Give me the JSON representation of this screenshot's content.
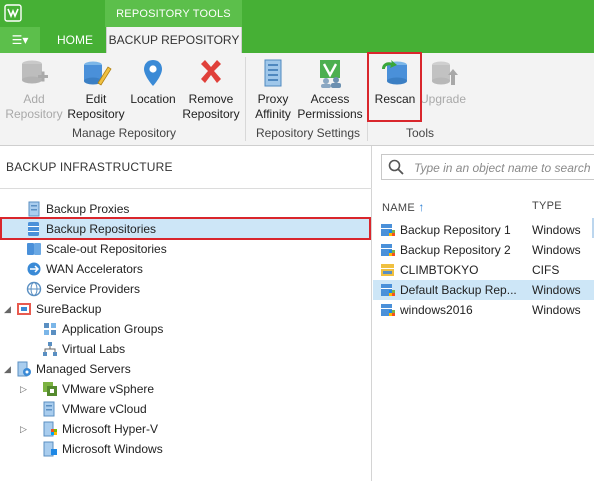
{
  "title_bar": {
    "context_tab": "REPOSITORY TOOLS"
  },
  "tabs": {
    "menu_glyph": "☰▾",
    "home": "HOME",
    "backup_repository": "BACKUP REPOSITORY"
  },
  "ribbon": {
    "manage": {
      "label": "Manage Repository",
      "add": {
        "line1": "Add",
        "line2": "Repository",
        "icon": "database-add-icon",
        "enabled": false
      },
      "edit": {
        "line1": "Edit",
        "line2": "Repository",
        "icon": "database-edit-icon"
      },
      "location": {
        "line1": "Location",
        "line2": "",
        "icon": "map-pin-icon"
      },
      "remove": {
        "line1": "Remove",
        "line2": "Repository",
        "icon": "red-x-icon"
      }
    },
    "settings": {
      "label": "Repository Settings",
      "proxy": {
        "line1": "Proxy",
        "line2": "Affinity",
        "icon": "proxy-affinity-icon"
      },
      "access": {
        "line1": "Access",
        "line2": "Permissions",
        "icon": "access-permissions-icon"
      }
    },
    "tools": {
      "label": "Tools",
      "rescan": {
        "line1": "Rescan",
        "icon": "rescan-icon"
      },
      "upgrade": {
        "line1": "Upgrade",
        "icon": "upgrade-icon",
        "enabled": false
      }
    }
  },
  "left_panel": {
    "header": "BACKUP INFRASTRUCTURE",
    "tree": [
      {
        "label": "Backup Proxies",
        "icon": "proxy-icon"
      },
      {
        "label": "Backup Repositories",
        "icon": "repository-icon",
        "selected": true
      },
      {
        "label": "Scale-out Repositories",
        "icon": "scaleout-icon"
      },
      {
        "label": "WAN Accelerators",
        "icon": "wan-icon"
      },
      {
        "label": "Service Providers",
        "icon": "service-provider-icon"
      },
      {
        "label": "SureBackup",
        "icon": "surebackup-icon",
        "expanded": true
      },
      {
        "label": "Application Groups",
        "icon": "app-groups-icon"
      },
      {
        "label": "Virtual Labs",
        "icon": "virtual-labs-icon"
      },
      {
        "label": "Managed Servers",
        "icon": "managed-servers-icon",
        "expanded": true
      },
      {
        "label": "VMware vSphere",
        "icon": "vsphere-icon",
        "collapsed": true
      },
      {
        "label": "VMware vCloud",
        "icon": "vcloud-icon"
      },
      {
        "label": "Microsoft Hyper-V",
        "icon": "hyperv-icon",
        "collapsed": true
      },
      {
        "label": "Microsoft Windows",
        "icon": "windows-server-icon"
      }
    ]
  },
  "right_panel": {
    "search_placeholder": "Type in an object name to search for",
    "columns": {
      "name": "NAME",
      "sort_glyph": "↑",
      "type": "TYPE"
    },
    "rows": [
      {
        "name": "Backup Repository 1",
        "type": "Windows"
      },
      {
        "name": "Backup Repository 2",
        "type": "Windows"
      },
      {
        "name": "CLIMBTOKYO",
        "type": "CIFS"
      },
      {
        "name": "Default Backup Rep...",
        "type": "Windows",
        "selected": true
      },
      {
        "name": "windows2016",
        "type": "Windows"
      }
    ]
  },
  "colors": {
    "accent_green": "#46b035",
    "selection_blue": "#cde6f7",
    "highlight_red": "#d9262c"
  }
}
